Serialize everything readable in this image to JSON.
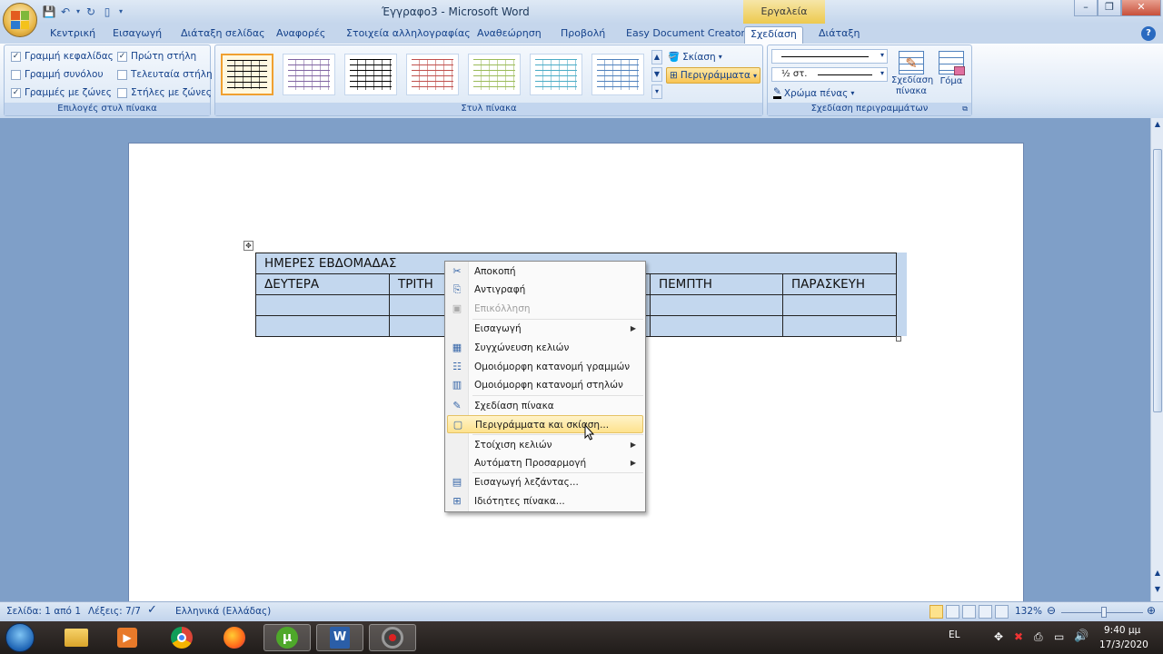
{
  "window": {
    "title": "Έγγραφο3 - Microsoft Word",
    "context_tab": "Εργαλεία πίνακα"
  },
  "tabs": [
    "Κεντρική",
    "Εισαγωγή",
    "Διάταξη σελίδας",
    "Αναφορές",
    "Στοιχεία αλληλογραφίας",
    "Αναθεώρηση",
    "Προβολή",
    "Easy Document Creator",
    "Σχεδίαση",
    "Διάταξη"
  ],
  "active_tab": "Σχεδίαση",
  "ribbon": {
    "style_options": {
      "label": "Επιλογές στυλ πίνακα",
      "items": [
        {
          "label": "Γραμμή κεφαλίδας",
          "checked": true
        },
        {
          "label": "Γραμμή συνόλου",
          "checked": false
        },
        {
          "label": "Γραμμές με ζώνες",
          "checked": true
        },
        {
          "label": "Πρώτη στήλη",
          "checked": true
        },
        {
          "label": "Τελευταία στήλη",
          "checked": false
        },
        {
          "label": "Στήλες με ζώνες",
          "checked": false
        }
      ]
    },
    "table_styles": {
      "label": "Στυλ πίνακα",
      "shading": "Σκίαση",
      "borders": "Περιγράμματα",
      "swatch_colors": [
        "#000000",
        "#8064a2",
        "#000000",
        "#c0504d",
        "#9bbb59",
        "#4bacc6",
        "#4f81bd"
      ]
    },
    "draw_borders": {
      "label": "Σχεδίαση περιγραμμάτων",
      "line_weight": "½ στ.",
      "pen_color": "Χρώμα πένας",
      "draw_table": "Σχεδίαση πίνακα",
      "eraser": "Γόμα"
    }
  },
  "table": {
    "title": "ΗΜΕΡΕΣ ΕΒΔΟΜΑΔΑΣ",
    "days": [
      "ΔΕΥΤΕΡΑ",
      "ΤΡΙΤΗ",
      "",
      "ΠΕΜΠΤΗ",
      "ΠΑΡΑΣΚΕΥΗ"
    ]
  },
  "context_menu": {
    "items": [
      {
        "label": "Αποκοπή",
        "icon": "cut-icon",
        "glyph": "✂"
      },
      {
        "label": "Αντιγραφή",
        "icon": "copy-icon",
        "glyph": "⎘"
      },
      {
        "label": "Επικόλληση",
        "icon": "paste-icon",
        "glyph": "📋"
      },
      {
        "label": "Εισαγωγή",
        "icon": "",
        "glyph": ""
      },
      {
        "label": "Συγχώνευση κελιών",
        "icon": "merge-cells-icon",
        "glyph": "▦"
      },
      {
        "label": "Ομοιόμορφη κατανομή γραμμών",
        "icon": "distribute-rows-icon",
        "glyph": "☷"
      },
      {
        "label": "Ομοιόμορφη κατανομή στηλών",
        "icon": "distribute-columns-icon",
        "glyph": "▥"
      },
      {
        "label": "Σχεδίαση πίνακα",
        "icon": "draw-table-icon",
        "glyph": "✎"
      },
      {
        "label": "Περιγράμματα και σκίαση...",
        "icon": "borders-shading-icon",
        "glyph": "▢"
      },
      {
        "label": "Στοίχιση κελιών",
        "icon": "",
        "glyph": ""
      },
      {
        "label": "Αυτόματη Προσαρμογή",
        "icon": "",
        "glyph": ""
      },
      {
        "label": "Εισαγωγή λεζάντας...",
        "icon": "caption-icon",
        "glyph": "▤"
      },
      {
        "label": "Ιδιότητες πίνακα...",
        "icon": "table-properties-icon",
        "glyph": "⊞"
      }
    ]
  },
  "status": {
    "page": "Σελίδα: 1 από 1",
    "words": "Λέξεις: 7/7",
    "language": "Ελληνικά (Ελλάδας)",
    "zoom": "132%"
  },
  "taskbar": {
    "lang": "EL",
    "time": "9:40 μμ",
    "date": "17/3/2020"
  }
}
